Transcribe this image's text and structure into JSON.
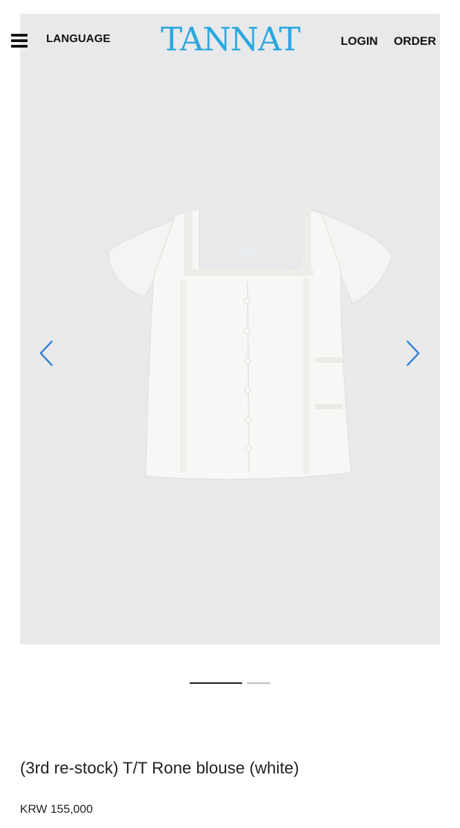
{
  "header": {
    "menu_icon": "hamburger-menu-icon",
    "language_label": "LANGUAGE",
    "logo_text": "TANNAT",
    "login_label": "LOGIN",
    "order_label": "ORDER"
  },
  "gallery": {
    "image_subject": "white blouse",
    "prev_icon": "chevron-left-icon",
    "next_icon": "chevron-right-icon",
    "current_slide": 1,
    "total_slides": 2
  },
  "product": {
    "name": "(3rd re-stock) T/T Rone blouse (white)",
    "price": "KRW 155,000"
  },
  "colors": {
    "logo": "#2aa7df",
    "arrow": "#2f7fd6",
    "image_background": "#e8e9eb"
  }
}
